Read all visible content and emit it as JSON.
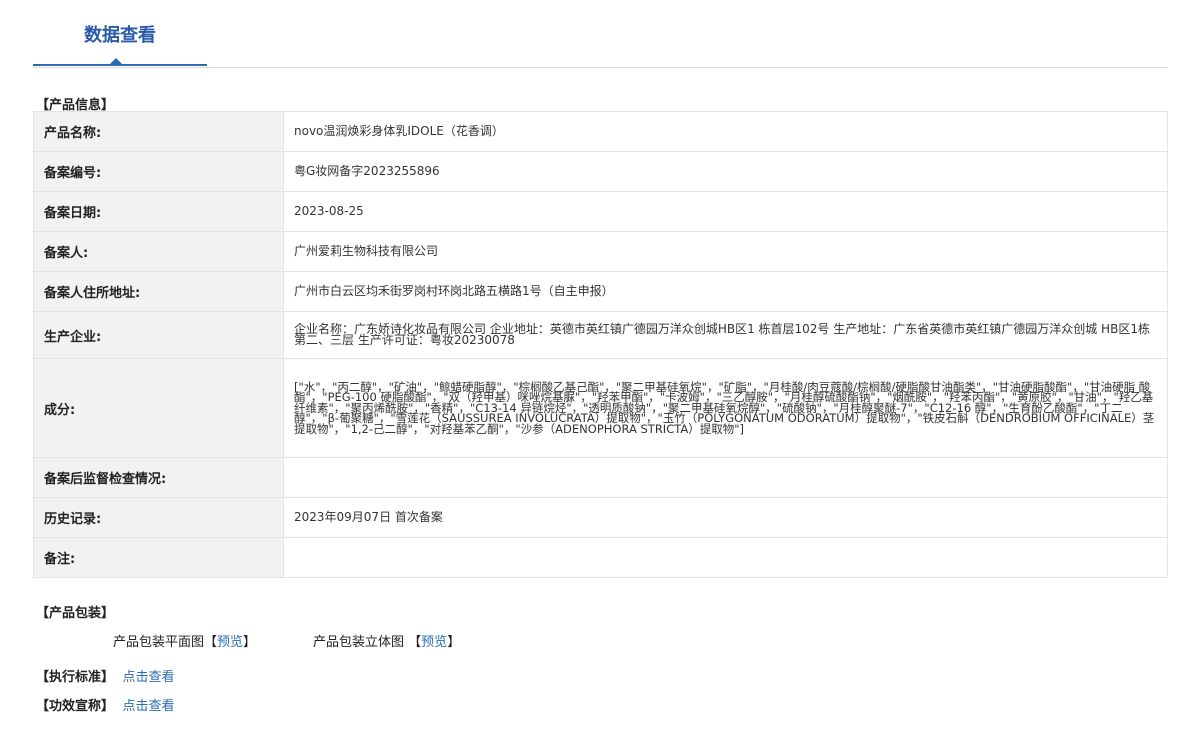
{
  "tab": {
    "title": "数据查看"
  },
  "product_info": {
    "section_title": "【产品信息】",
    "rows": [
      {
        "label": "产品名称:",
        "value": "novo温润焕彩身体乳IDOLE（花香调）"
      },
      {
        "label": "备案编号:",
        "value": "粤G妆网备字2023255896"
      },
      {
        "label": "备案日期:",
        "value": "2023-08-25"
      },
      {
        "label": "备案人:",
        "value": "广州爱莉生物科技有限公司"
      },
      {
        "label": "备案人住所地址:",
        "value": "广州市白云区均禾街罗岗村环岗北路五横路1号（自主申报）"
      },
      {
        "label": "生产企业:",
        "value": "企业名称：广东娇诗化妆品有限公司 企业地址：英德市英红镇广德园万洋众创城HB区1 栋首层102号 生产地址：广东省英德市英红镇广德园万洋众创城 HB区1栋第二、三层 生产许可证：粤妆20230078"
      },
      {
        "label": "成分:",
        "value": "[\"水\"，\"丙二醇\"，\"矿油\"，\"鲸蜡硬脂醇\"，\"棕榈酸乙基己酯\"，\"聚二甲基硅氧烷\"，\"矿脂\"，\"月桂酸/肉豆蔻酸/棕榈酸/硬脂酸甘油酯类\"，\"甘油硬脂酸酯\"，\"甘油硬脂 酸酯\"，\"PEG-100 硬脂酸酯\"，\"双（羟甲基）咪唑烷基脲\"，\"羟苯甲酯\"，\"卡波姆\"，\"三乙醇胺\"，\"月桂醇硫酸酯钠\"，\"烟酰胺\"，\"羟苯丙酯\"，\"黄原胶\"，\"甘油\"，\"羟乙基纤维素\"，\"聚丙烯酰胺\"，\"香精\"，\"C13-14 异链烷烃\"，\"透明质酸钠\"，\"聚二甲基硅氧烷醇\"，\"硫酸钠\"，\"月桂醇聚醚-7\"，\"C12-16 醇\"，\"生育酚乙酸酯\"，\"丁二醇\"，\"β-葡聚糖\"，\"雪莲花（SAUSSUREA INVOLUCRATA）提取物\"，\"玉竹（POLYGONATUM ODORATUM）提取物\"，\"铁皮石斛（DENDROBIUM OFFICINALE）茎提取物\"，\"1,2-己二醇\"，\"对羟基苯乙酮\"，\"沙参（ADENOPHORA STRICTA）提取物\"]"
      },
      {
        "label": "备案后监督检查情况:",
        "value": ""
      },
      {
        "label": "历史记录:",
        "value": "2023年09月07日 首次备案"
      },
      {
        "label": "备注:",
        "value": ""
      }
    ]
  },
  "packaging": {
    "section_title": "【产品包装】",
    "flat_label": "产品包装平面图",
    "flat_link": "预览",
    "stereo_label": "产品包装立体图",
    "stereo_link": "预览",
    "bracket_open": "【",
    "bracket_close": "】"
  },
  "standard": {
    "title": "【执行标准】",
    "link": "点击查看"
  },
  "efficacy": {
    "title": "【功效宣称】",
    "link": "点击查看"
  }
}
